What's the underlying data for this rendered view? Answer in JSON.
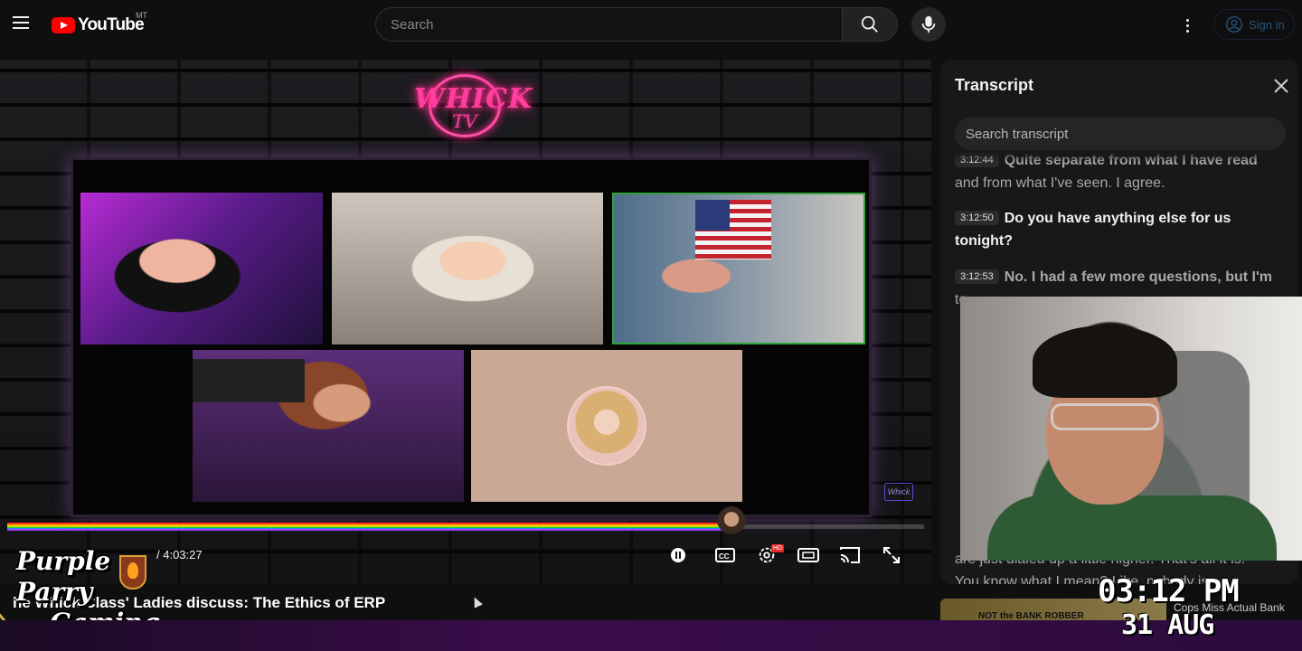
{
  "header": {
    "logo_text": "YouTube",
    "country_code": "MT",
    "search_placeholder": "Search",
    "signin_label": "Sign in"
  },
  "video": {
    "neon_logo_line1": "WHICK",
    "neon_logo_line2": "TV",
    "time_display": "/ 4:03:27",
    "progress_fraction": 0.79,
    "title": "he Whick Class' Ladies discuss: The Ethics of ERP",
    "overlay_line1": "Purple",
    "overlay_line2": "Parry",
    "overlay_line3": "Gaming"
  },
  "controls": {
    "pause": "pause-icon",
    "captions": "cc-icon",
    "settings": "settings-icon",
    "settings_badge": "HD",
    "theater": "theater-icon",
    "cast": "cast-icon",
    "fullscreen": "fullscreen-icon"
  },
  "transcript": {
    "title": "Transcript",
    "search_placeholder": "Search transcript",
    "segments": [
      {
        "ts": "3:12:44",
        "first": "Quite separate from what I have read",
        "rest": "and from what I've seen. I agree."
      },
      {
        "ts": "3:12:50",
        "first": "Do you have anything else for us",
        "rest": "tonight?"
      },
      {
        "ts": "3:12:53",
        "first": "No. I had a few more questions, but I'm",
        "rest": "to..."
      }
    ],
    "partial_bottom": "are just dialed up a little higher. That's all it is.",
    "partial_bottom2": "You know what I mean? Like, nobody is..."
  },
  "clock": {
    "time": "03:12 PM",
    "date": "31 AUG"
  },
  "recommendations": {
    "peek1_text": "NOT the BANK ROBBER",
    "peek2_text": "Cops Miss Actual Bank"
  },
  "colors": {
    "brand_red": "#ff0000",
    "neon_pink": "#ff3fa0",
    "link_blue": "#3ea6ff",
    "background": "#0f0f0f"
  }
}
